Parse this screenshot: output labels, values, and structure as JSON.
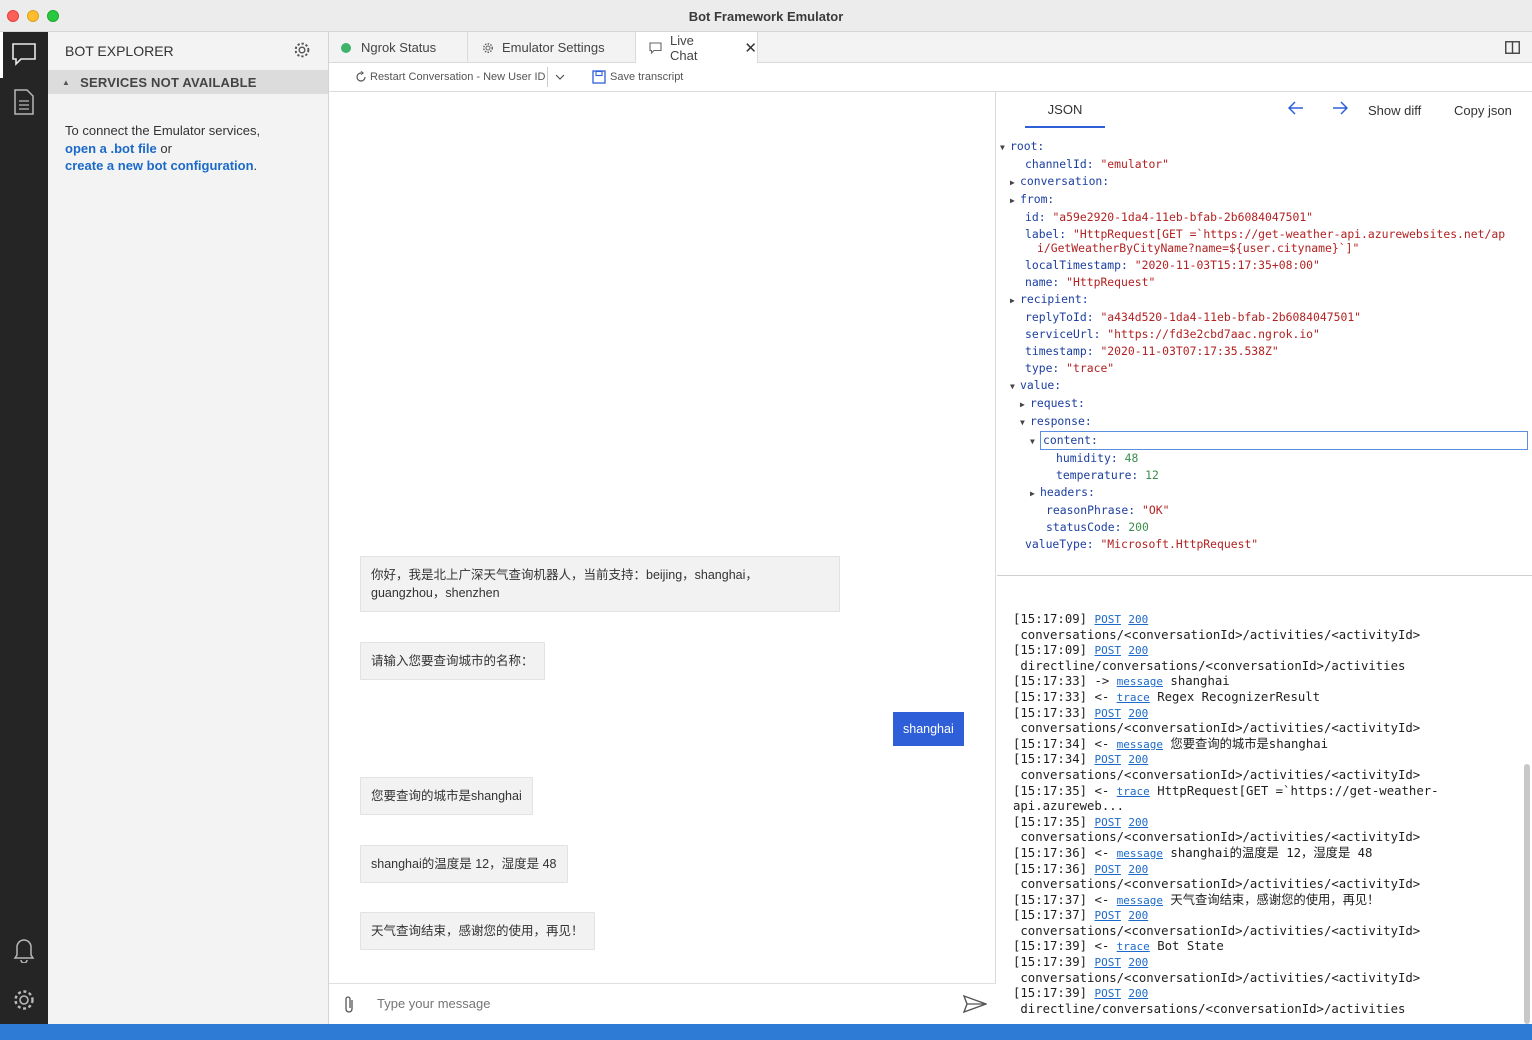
{
  "window": {
    "title": "Bot Framework Emulator"
  },
  "explorer": {
    "title": "BOT EXPLORER",
    "services_label": "SERVICES NOT AVAILABLE",
    "message_prefix": "To connect the Emulator services,",
    "open_link": "open a .bot file",
    "or_text": " or",
    "create_link": "create a new bot configuration",
    "period": "."
  },
  "tabs": {
    "ngrok": "Ngrok Status",
    "settings": "Emulator Settings",
    "live_chat": "Live Chat"
  },
  "toolbar": {
    "restart_label": "Restart Conversation - New User ID",
    "save_label": "Save transcript"
  },
  "chat": {
    "messages": [
      {
        "from": "bot",
        "text": "你好，我是北上广深天气查询机器人，当前支持：beijing，shanghai，guangzhou，shenzhen"
      },
      {
        "from": "bot",
        "text": "请输入您要查询城市的名称："
      },
      {
        "from": "user",
        "text": "shanghai"
      },
      {
        "from": "bot",
        "text": "您要查询的城市是shanghai"
      },
      {
        "from": "bot",
        "text": "shanghai的温度是 12，湿度是 48"
      },
      {
        "from": "bot",
        "text": "天气查询结束，感谢您的使用，再见！"
      }
    ],
    "input_placeholder": "Type your message"
  },
  "inspector": {
    "tab_label": "JSON",
    "show_diff": "Show diff",
    "copy_json": "Copy json",
    "tree": {
      "root": "root:",
      "channelId_key": "channelId:",
      "channelId_val": "\"emulator\"",
      "conversation_key": "conversation:",
      "from_key": "from:",
      "id_key": "id:",
      "id_val": "\"a59e2920-1da4-11eb-bfab-2b6084047501\"",
      "label_key": "label:",
      "label_val_1": "\"HttpRequest[GET =`https://get-weather-api.azurewebsites.net/ap",
      "label_val_2": "i/GetWeatherByCityName?name=${user.cityname}`]\"",
      "localTimestamp_key": "localTimestamp:",
      "localTimestamp_val": "\"2020-11-03T15:17:35+08:00\"",
      "name_key": "name:",
      "name_val": "\"HttpRequest\"",
      "recipient_key": "recipient:",
      "replyToId_key": "replyToId:",
      "replyToId_val": "\"a434d520-1da4-11eb-bfab-2b6084047501\"",
      "serviceUrl_key": "serviceUrl:",
      "serviceUrl_val": "\"https://fd3e2cbd7aac.ngrok.io\"",
      "timestamp_key": "timestamp:",
      "timestamp_val": "\"2020-11-03T07:17:35.538Z\"",
      "type_key": "type:",
      "type_val": "\"trace\"",
      "value_key": "value:",
      "request_key": "request:",
      "response_key": "response:",
      "content_key": "content:",
      "humidity_key": "humidity:",
      "humidity_val": "48",
      "temperature_key": "temperature:",
      "temperature_val": "12",
      "headers_key": "headers:",
      "reasonPhrase_key": "reasonPhrase:",
      "reasonPhrase_val": "\"OK\"",
      "statusCode_key": "statusCode:",
      "statusCode_val": "200",
      "valueType_key": "valueType:",
      "valueType_val": "\"Microsoft.HttpRequest\""
    }
  },
  "log": {
    "rows": [
      {
        "time": "[15:17:09]",
        "dir": "",
        "link": "POST",
        "code": "200",
        "text": ""
      },
      {
        "time": "",
        "dir": "",
        "link": "",
        "code": "",
        "text": " conversations/<conversationId>/activities/<activityId>"
      },
      {
        "time": "[15:17:09]",
        "dir": "",
        "link": "POST",
        "code": "200",
        "text": ""
      },
      {
        "time": "",
        "dir": "",
        "link": "",
        "code": "",
        "text": " directline/conversations/<conversationId>/activities"
      },
      {
        "time": "[15:17:33]",
        "dir": " ->",
        "link": "message",
        "code": "",
        "text": " shanghai"
      },
      {
        "time": "[15:17:33]",
        "dir": " <-",
        "link": "trace",
        "code": "",
        "text": " Regex RecognizerResult"
      },
      {
        "time": "[15:17:33]",
        "dir": "",
        "link": "POST",
        "code": "200",
        "text": ""
      },
      {
        "time": "",
        "dir": "",
        "link": "",
        "code": "",
        "text": " conversations/<conversationId>/activities/<activityId>"
      },
      {
        "time": "[15:17:34]",
        "dir": " <-",
        "link": "message",
        "code": "",
        "text": " 您要查询的城市是shanghai"
      },
      {
        "time": "[15:17:34]",
        "dir": "",
        "link": "POST",
        "code": "200",
        "text": ""
      },
      {
        "time": "",
        "dir": "",
        "link": "",
        "code": "",
        "text": " conversations/<conversationId>/activities/<activityId>"
      },
      {
        "time": "[15:17:35]",
        "dir": " <-",
        "link": "trace",
        "code": "",
        "text": " HttpRequest[GET =`https://get-weather-"
      },
      {
        "time": "",
        "dir": "",
        "link": "",
        "code": "",
        "text": "api.azureweb..."
      },
      {
        "time": "[15:17:35]",
        "dir": "",
        "link": "POST",
        "code": "200",
        "text": ""
      },
      {
        "time": "",
        "dir": "",
        "link": "",
        "code": "",
        "text": " conversations/<conversationId>/activities/<activityId>"
      },
      {
        "time": "[15:17:36]",
        "dir": " <-",
        "link": "message",
        "code": "",
        "text": " shanghai的温度是 12，湿度是 48"
      },
      {
        "time": "[15:17:36]",
        "dir": "",
        "link": "POST",
        "code": "200",
        "text": ""
      },
      {
        "time": "",
        "dir": "",
        "link": "",
        "code": "",
        "text": " conversations/<conversationId>/activities/<activityId>"
      },
      {
        "time": "[15:17:37]",
        "dir": " <-",
        "link": "message",
        "code": "",
        "text": " 天气查询结束，感谢您的使用，再见！"
      },
      {
        "time": "[15:17:37]",
        "dir": "",
        "link": "POST",
        "code": "200",
        "text": ""
      },
      {
        "time": "",
        "dir": "",
        "link": "",
        "code": "",
        "text": " conversations/<conversationId>/activities/<activityId>"
      },
      {
        "time": "[15:17:39]",
        "dir": " <-",
        "link": "trace",
        "code": "",
        "text": " Bot State"
      },
      {
        "time": "[15:17:39]",
        "dir": "",
        "link": "POST",
        "code": "200",
        "text": ""
      },
      {
        "time": "",
        "dir": "",
        "link": "",
        "code": "",
        "text": " conversations/<conversationId>/activities/<activityId>"
      },
      {
        "time": "[15:17:39]",
        "dir": "",
        "link": "POST",
        "code": "200",
        "text": ""
      },
      {
        "time": "",
        "dir": "",
        "link": "",
        "code": "",
        "text": " directline/conversations/<conversationId>/activities"
      }
    ]
  },
  "icons": {
    "chat": "chat-icon",
    "transcript": "document-icon",
    "bell": "bell-icon",
    "settings": "gear-icon",
    "attach": "paperclip-icon",
    "send": "send-icon"
  },
  "colors": {
    "accent": "#2e5fd9",
    "status_bar": "#2e7bd6",
    "rail": "#252526",
    "ngrok_ok": "#3fb26b"
  }
}
